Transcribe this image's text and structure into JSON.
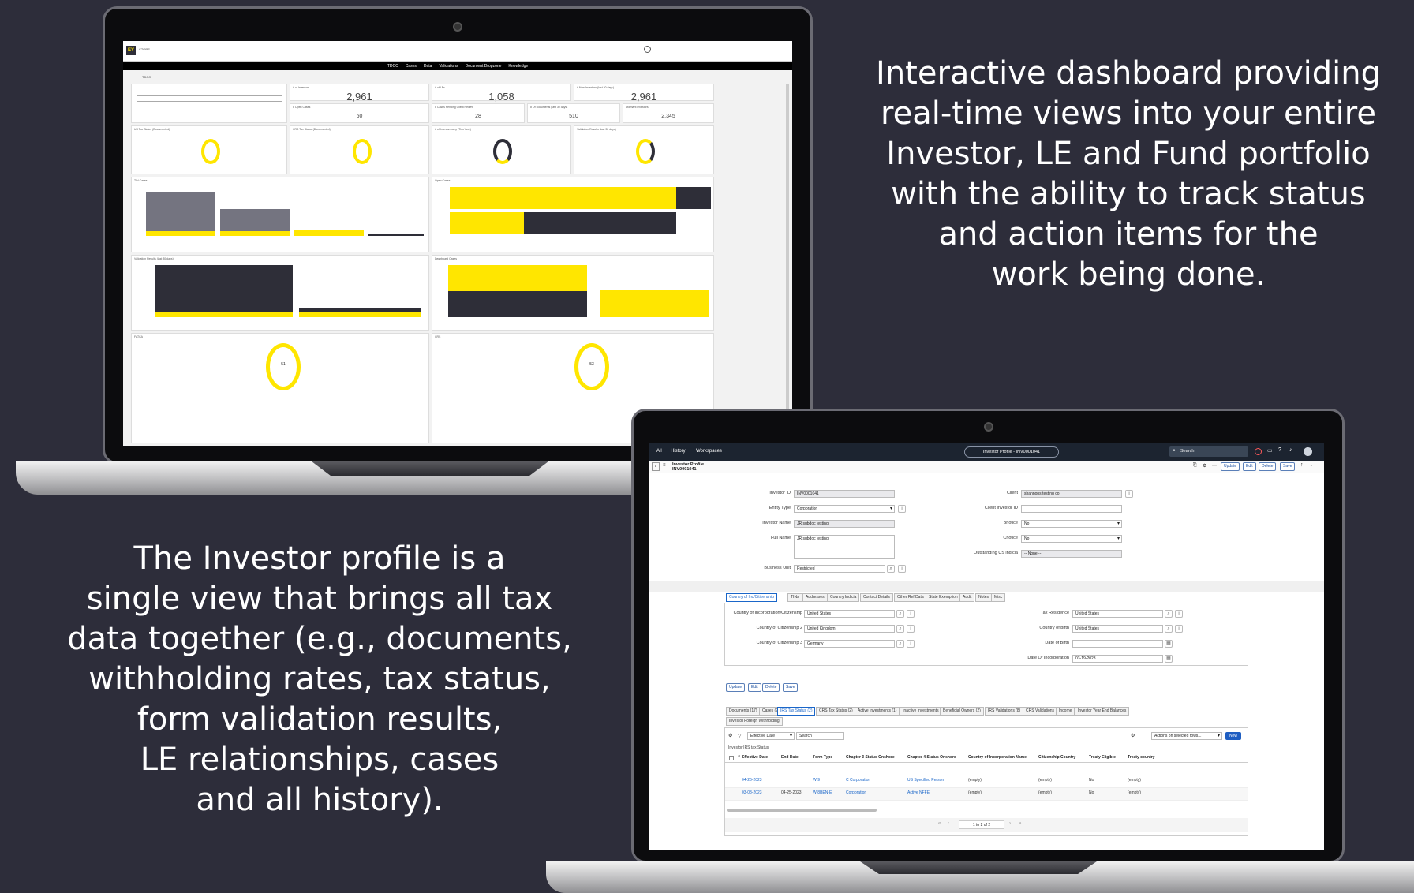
{
  "right_text": "Interactive dashboard providing\nreal-time views into your entire\nInvestor, LE and Fund portfolio\nwith the ability to track status\nand action items for the\nwork being done.",
  "left_text": "The Investor profile is a\nsingle view that brings all tax\ndata together (e.g., documents,\nwithholding rates, tax status,\nform validation results,\nLE relationships, cases\nand all history).",
  "dashboard": {
    "logo": "EY",
    "brand": "CTORS",
    "nav": [
      "TDCC",
      "Cases",
      "Data",
      "Validations",
      "Document Dropzone",
      "Knowledge"
    ],
    "breadcrumb": "TDCC",
    "kpis": [
      {
        "label": "# of Investors",
        "value": "2,961"
      },
      {
        "label": "# of LEs",
        "value": "1,058"
      },
      {
        "label": "# New Investors (last 30 days)",
        "value": "2,961"
      }
    ],
    "small_kpis": [
      {
        "label": "# Open Cases",
        "value": "60"
      },
      {
        "label": "# Cases Pending Client Review",
        "value": "28"
      },
      {
        "label": "# Of Documents (last 30 days)",
        "value": "510"
      },
      {
        "label": "Dormant Investors",
        "value": "2,345"
      }
    ],
    "donut_titles": [
      "US Tax Status (Documented)",
      "CRS Tax Status (Documented)",
      "# of Intercompany (This Year)",
      "Validation Results (last 30 days)"
    ],
    "panel_titles": [
      "TIN Cases",
      "Open Cases",
      "Validation Results (last 30 days)",
      "Dashboard Cases",
      "FATCA",
      "CRS"
    ],
    "ring_values": [
      "51",
      "53"
    ],
    "colors": {
      "yellow": "#ffe600",
      "dark": "#2e2e38",
      "gray": "#747480"
    }
  },
  "profile": {
    "top_links": [
      "All",
      "History",
      "Workspaces"
    ],
    "title_pill": "Investor Profile - INV0001041",
    "search_placeholder": "Search",
    "sub_title": "Investor Profile",
    "sub_id": "INV0001041",
    "actions": [
      "Update",
      "Edit",
      "Delete",
      "Save"
    ],
    "fields_left": [
      {
        "label": "Investor ID",
        "value": "INV0001041"
      },
      {
        "label": "Entity Type",
        "value": "Corporation"
      },
      {
        "label": "Investor Name",
        "value": "JR subdoc testing"
      },
      {
        "label": "Full Name",
        "value": "JR subdoc testing"
      },
      {
        "label": "Business Unit",
        "value": "Restricted"
      }
    ],
    "fields_right": [
      {
        "label": "Client",
        "value": "shannons testing co"
      },
      {
        "label": "Client Investor ID",
        "value": ""
      },
      {
        "label": "Bnotice",
        "value": "No"
      },
      {
        "label": "Cnotice",
        "value": "No"
      },
      {
        "label": "Outstanding US indicia",
        "value": "-- None --"
      }
    ],
    "tabs1": [
      "Country of Inc/Citizenship",
      "TINs",
      "Addresses",
      "Country Indicia",
      "Contact Details",
      "Other Ref Data",
      "State Exemption",
      "Audit",
      "Notes",
      "Misc"
    ],
    "citizen_left": [
      {
        "label": "Country of Incorporation/Citizenship",
        "value": "United States"
      },
      {
        "label": "Country of Citizenship 2",
        "value": "United Kingdom"
      },
      {
        "label": "Country of Citizenship 3",
        "value": "Germany"
      }
    ],
    "citizen_right": [
      {
        "label": "Tax Residence",
        "value": "United States"
      },
      {
        "label": "Country of birth",
        "value": "United States"
      },
      {
        "label": "Date of Birth",
        "value": ""
      },
      {
        "label": "Date Of Incorporation",
        "value": "03-19-2023"
      }
    ],
    "tabs2": [
      "Documents (17)",
      "Cases (9)",
      "IRS Tax Status (2)",
      "CRS Tax Status (2)",
      "Active Investments (1)",
      "Inactive Investments",
      "Beneficial Owners (2)",
      "IRS Validations (8)",
      "CRS Validations",
      "Income",
      "Investor Year End Balances"
    ],
    "tab2_extra": "Investor Foreign Withholding",
    "list_filter": "Effective Date",
    "list_search": "Search",
    "list_actions": "Actions on selected rows...",
    "list_new": "New",
    "list_caption": "Investor IRS tax Status",
    "columns": [
      "Effective Date",
      "End Date",
      "Form Type",
      "Chapter 3 Status Onshore",
      "Chapter 4 Status Onshore",
      "Country of Incorporation Name",
      "Citizenship Country",
      "Treaty Eligible",
      "Treaty country"
    ],
    "rows": [
      [
        "04-26-2023",
        "",
        "W-9",
        "C Corporation",
        "US Specified Person",
        "(empty)",
        "(empty)",
        "No",
        "(empty)"
      ],
      [
        "03-08-2023",
        "04-25-2023",
        "W-8BEN-E",
        "Corporation",
        "Active NFFE",
        "(empty)",
        "(empty)",
        "No",
        "(empty)"
      ]
    ],
    "pager": "1 to 2 of 2"
  }
}
